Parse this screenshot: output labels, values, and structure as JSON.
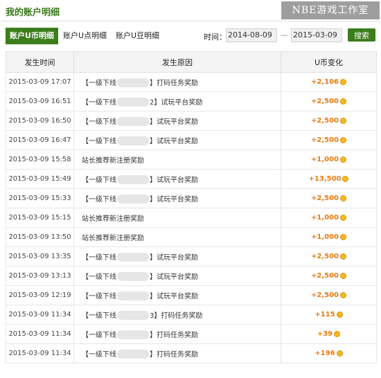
{
  "header": {
    "title": "我的账户明细",
    "watermark": "NBE游戏工作室"
  },
  "tabs": [
    {
      "label": "账户U币明细",
      "active": true
    },
    {
      "label": "账户U点明细",
      "active": false
    },
    {
      "label": "账户U豆明细",
      "active": false
    }
  ],
  "filter": {
    "time_label": "时间：",
    "start_date": "2014-08-09",
    "separator": "—",
    "end_date": "2015-03-09",
    "search_label": "搜索"
  },
  "table": {
    "columns": [
      "发生时间",
      "发生原因",
      "U币变化"
    ],
    "rows": [
      {
        "time": "2015-03-09 17:07",
        "reason_prefix": "【一级下线",
        "reason_suffix": "】打码任务奖励",
        "masked": true,
        "amount": "+2,106"
      },
      {
        "time": "2015-03-09 16:51",
        "reason_prefix": "【一级下线",
        "reason_suffix": "2】试玩平台奖励",
        "masked": true,
        "amount": "+2,500"
      },
      {
        "time": "2015-03-09 16:50",
        "reason_prefix": "【一级下线",
        "reason_suffix": "】试玩平台奖励",
        "masked": true,
        "amount": "+2,500"
      },
      {
        "time": "2015-03-09 16:47",
        "reason_prefix": "【一级下线",
        "reason_suffix": "】试玩平台奖励",
        "masked": true,
        "amount": "+2,500"
      },
      {
        "time": "2015-03-09 15:58",
        "reason_prefix": "站长推荐新注册奖励",
        "reason_suffix": "",
        "masked": false,
        "amount": "+1,000"
      },
      {
        "time": "2015-03-09 15:49",
        "reason_prefix": "【一级下线",
        "reason_suffix": "】试玩平台奖励",
        "masked": true,
        "amount": "+13,500"
      },
      {
        "time": "2015-03-09 15:33",
        "reason_prefix": "【一级下线",
        "reason_suffix": "】试玩平台奖励",
        "masked": true,
        "amount": "+2,500"
      },
      {
        "time": "2015-03-09 15:15",
        "reason_prefix": "站长推荐新注册奖励",
        "reason_suffix": "",
        "masked": false,
        "amount": "+1,000"
      },
      {
        "time": "2015-03-09 13:50",
        "reason_prefix": "站长推荐新注册奖励",
        "reason_suffix": "",
        "masked": false,
        "amount": "+1,000"
      },
      {
        "time": "2015-03-09 13:35",
        "reason_prefix": "【一级下线",
        "reason_suffix": "】试玩平台奖励",
        "masked": true,
        "amount": "+2,500"
      },
      {
        "time": "2015-03-09 13:13",
        "reason_prefix": "【一级下线",
        "reason_suffix": "】试玩平台奖励",
        "masked": true,
        "amount": "+2,500"
      },
      {
        "time": "2015-03-09 12:19",
        "reason_prefix": "【一级下线",
        "reason_suffix": "】试玩平台奖励",
        "masked": true,
        "amount": "+2,500"
      },
      {
        "time": "2015-03-09 11:34",
        "reason_prefix": "【一级下线",
        "reason_suffix": "3】打码任务奖励",
        "masked": true,
        "amount": "+115"
      },
      {
        "time": "2015-03-09 11:34",
        "reason_prefix": "【一级下线",
        "reason_suffix": "】打码任务奖励",
        "masked": true,
        "amount": "+39"
      },
      {
        "time": "2015-03-09 11:34",
        "reason_prefix": "【一级下线",
        "reason_suffix": "】打码任务奖励",
        "masked": true,
        "amount": "+196"
      }
    ]
  },
  "icons": {
    "coin": "coin-icon"
  },
  "colors": {
    "accent_green": "#3c7d1c",
    "amount_orange": "#e87a10",
    "coin_gold": "#f5b820"
  }
}
